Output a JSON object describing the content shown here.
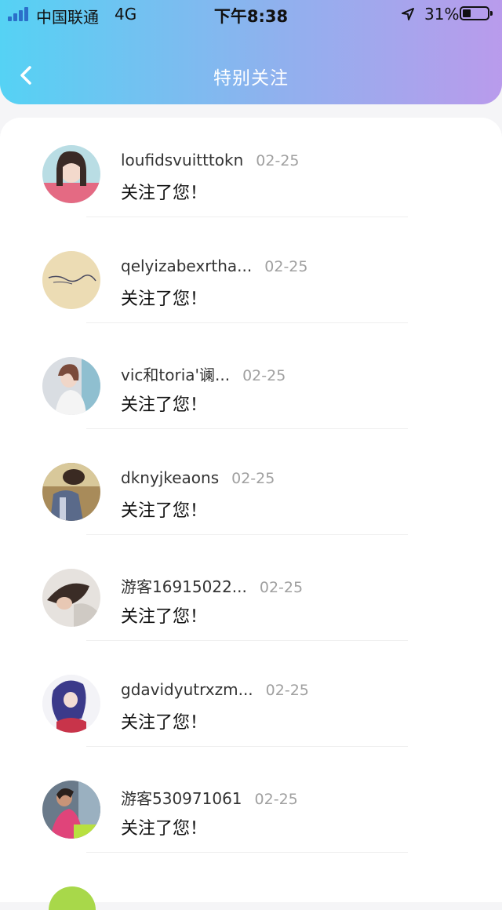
{
  "status_bar": {
    "carrier": "中国联通",
    "network": "4G",
    "time": "下午8:38",
    "battery_percent": "31%",
    "signal_color": "#2b6fc9"
  },
  "header": {
    "title": "特别关注",
    "back_icon": "chevron-left-icon",
    "gradient": [
      "#55d2f4",
      "#8fb1ee",
      "#b99bec"
    ]
  },
  "list": [
    {
      "name": "loufidsvuitttokn",
      "date": "02-25",
      "message": "关注了您！"
    },
    {
      "name": "qelyizabexrtha...",
      "date": "02-25",
      "message": "关注了您！"
    },
    {
      "name": "vic和toria'谰...",
      "date": "02-25",
      "message": "关注了您！"
    },
    {
      "name": "dknyjkeaons",
      "date": "02-25",
      "message": "关注了您！"
    },
    {
      "name": "游客16915022...",
      "date": "02-25",
      "message": "关注了您！"
    },
    {
      "name": "gdavidyutrxzm...",
      "date": "02-25",
      "message": "关注了您！"
    },
    {
      "name": "游客530971061",
      "date": "02-25",
      "message": "关注了您！"
    }
  ]
}
